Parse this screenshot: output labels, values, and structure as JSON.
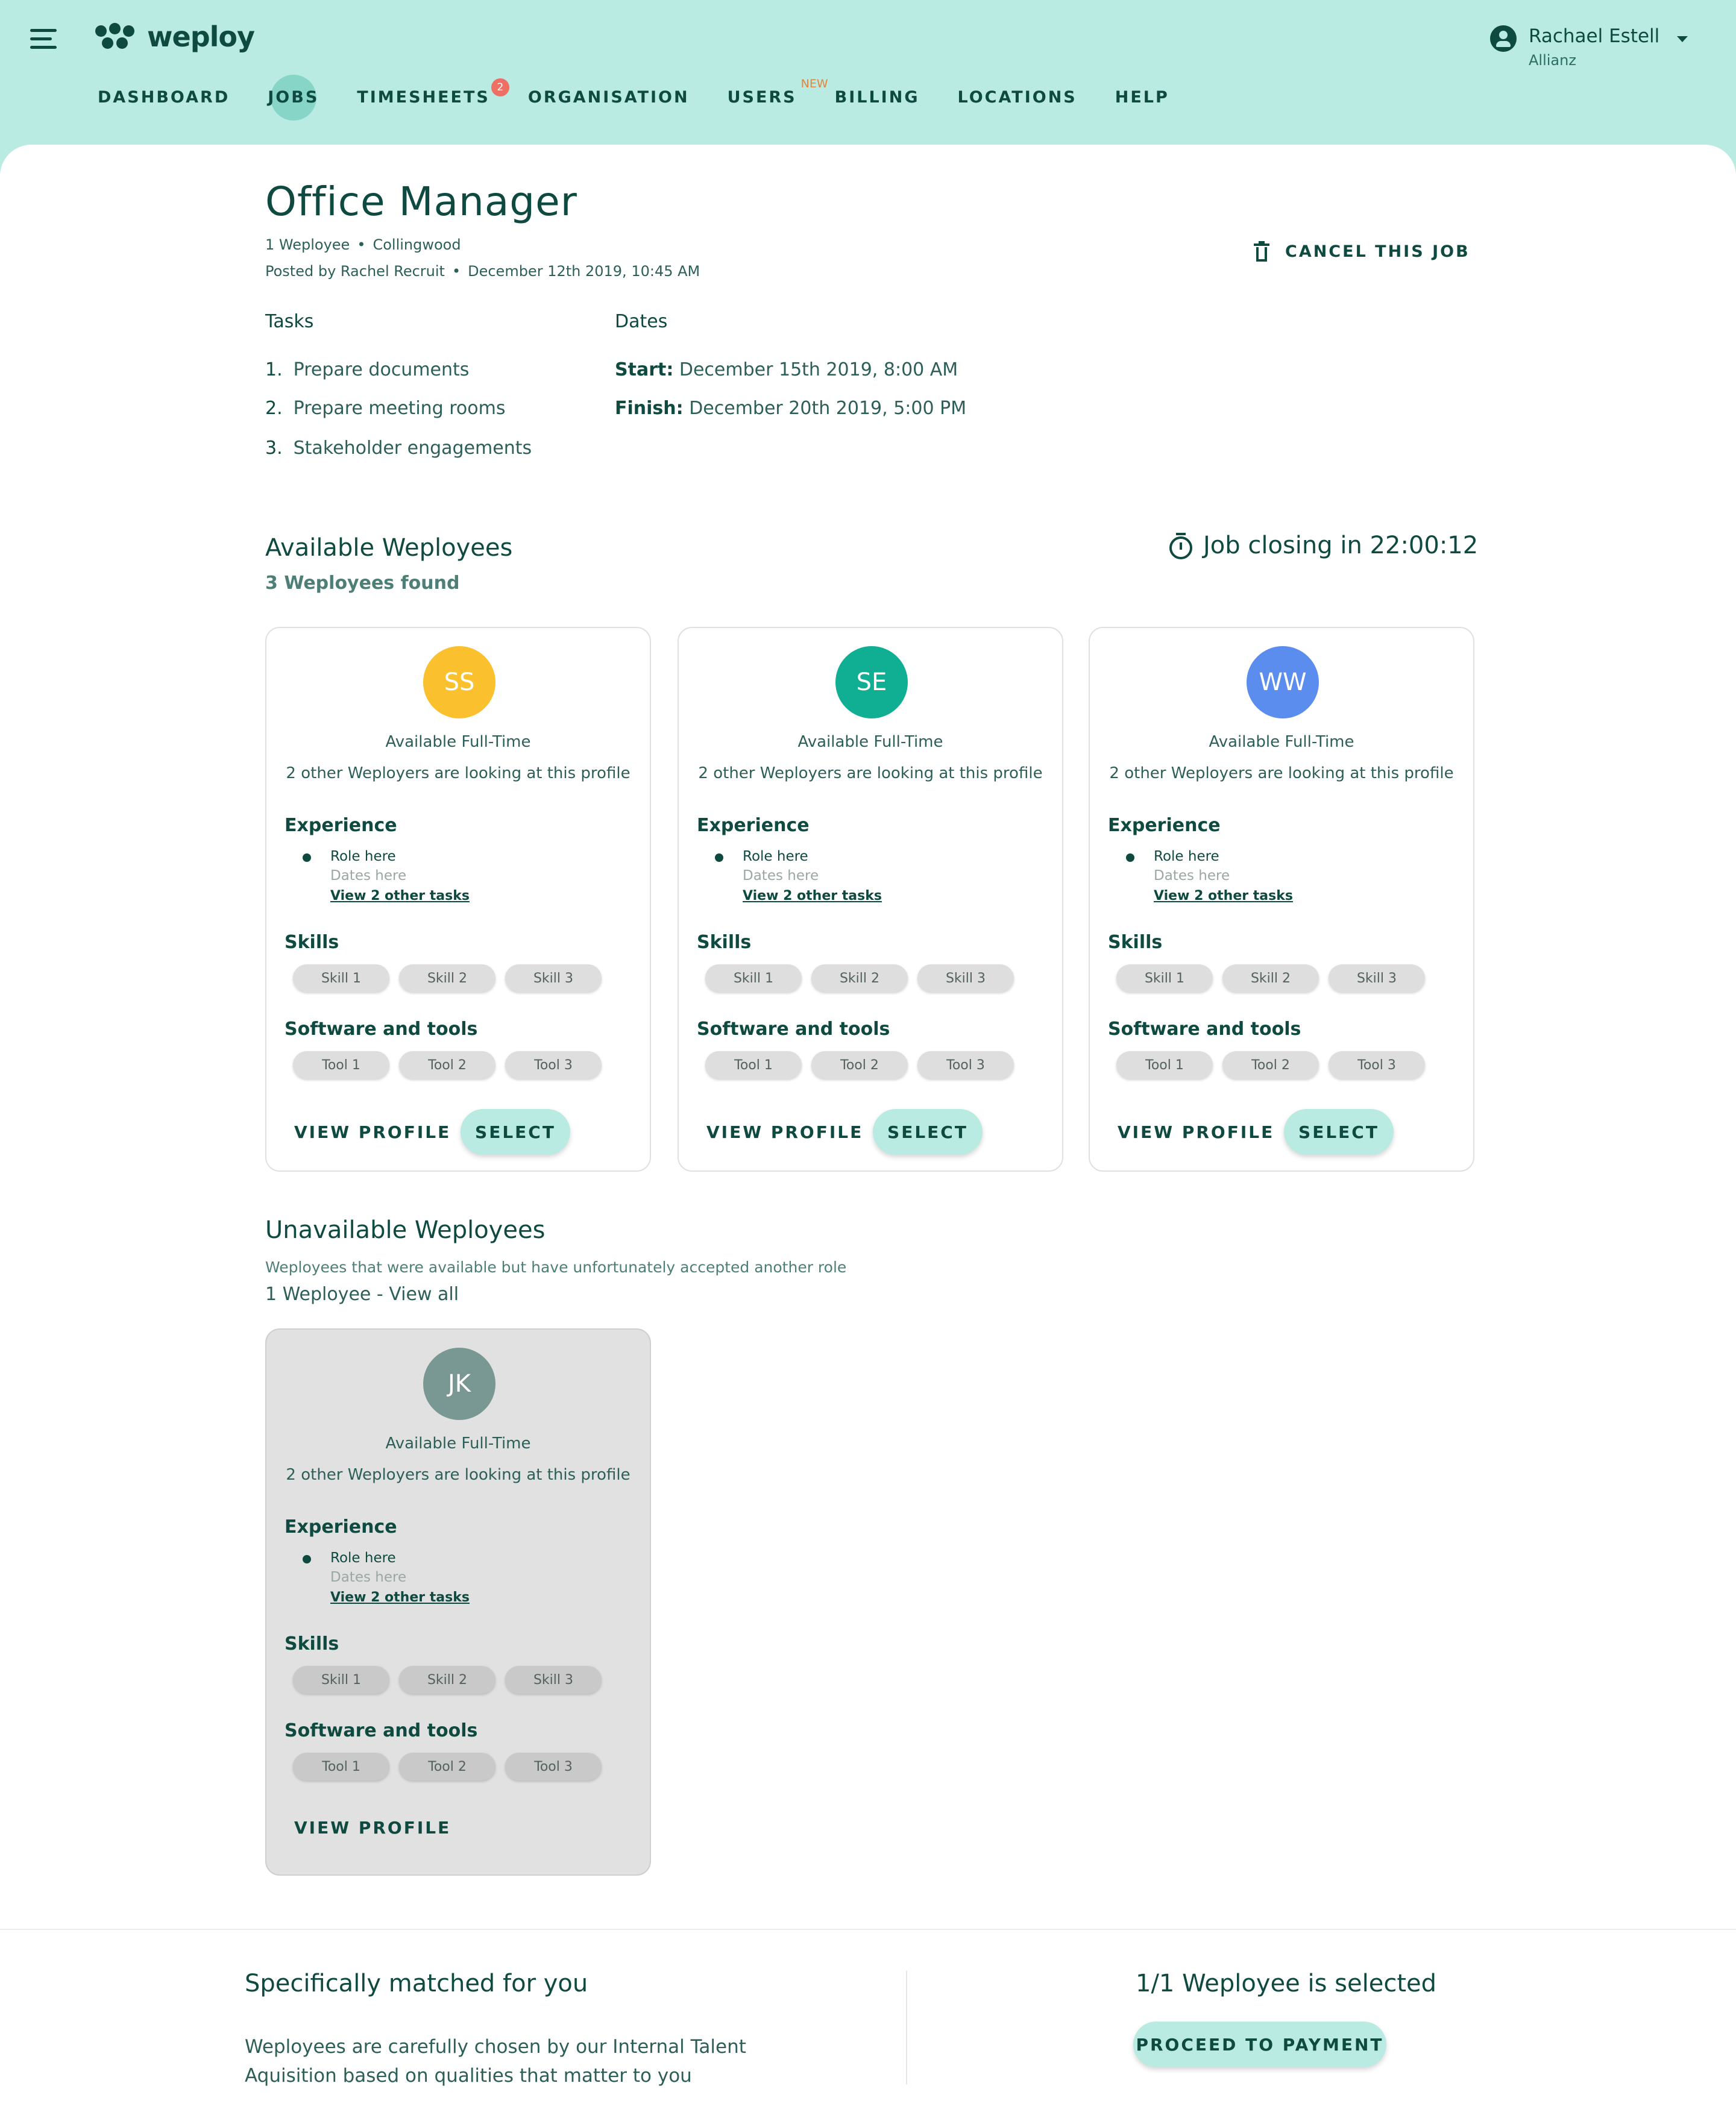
{
  "brand": {
    "name": "weploy",
    "primary": "#b9ebe3",
    "text": "#0e4a40",
    "badge": "#ee6f64",
    "new_tag": "#e8823a"
  },
  "header": {
    "menu_icon": "hamburger-icon",
    "nav": [
      {
        "label": "DASHBOARD",
        "active": false
      },
      {
        "label": "JOBS",
        "active": true
      },
      {
        "label": "TIMESHEETS",
        "active": false,
        "badge": "2"
      },
      {
        "label": "ORGANISATION",
        "active": false
      },
      {
        "label": "USERS",
        "active": false,
        "tag": "NEW"
      },
      {
        "label": "BILLING",
        "active": false
      },
      {
        "label": "LOCATIONS",
        "active": false
      },
      {
        "label": "HELP",
        "active": false
      }
    ],
    "user": {
      "name": "Rachael Estell",
      "org": "Allianz",
      "icon": "account-circle-icon"
    }
  },
  "job": {
    "title": "Office Manager",
    "weployees": "1 Weployee",
    "location": "Collingwood",
    "posted_by": "Posted by Rachel Recruit",
    "posted_at": "December 12th 2019, 10:45 AM",
    "cancel_label": "CANCEL THIS JOB",
    "tasks_heading": "Tasks",
    "tasks": [
      "Prepare documents",
      "Prepare meeting rooms",
      "Stakeholder engagements"
    ],
    "dates_heading": "Dates",
    "start_label": "Start:",
    "start": "December 15th 2019, 8:00 AM",
    "finish_label": "Finish:",
    "finish": "December 20th 2019, 5:00 PM"
  },
  "available": {
    "title": "Available Weployees",
    "found": "3 Weployees found",
    "closing": "Job closing in 22:00:12",
    "cards": [
      {
        "initials": "SS",
        "color": "#fbc02d"
      },
      {
        "initials": "SE",
        "color": "#10ae93"
      },
      {
        "initials": "WW",
        "color": "#5b8def"
      }
    ]
  },
  "card_common": {
    "availability": "Available Full-Time",
    "looking": "2 other Weployers are looking at this profile",
    "experience_heading": "Experience",
    "role": "Role here",
    "dates": "Dates here",
    "other_tasks": "View 2 other tasks",
    "skills_heading": "Skills",
    "skills": [
      "Skill 1",
      "Skill 2",
      "Skill 3"
    ],
    "tools_heading": "Software and tools",
    "tools": [
      "Tool 1",
      "Tool 2",
      "Tool 3"
    ],
    "view_profile": "VIEW PROFILE",
    "select": "SELECT"
  },
  "unavailable": {
    "title": "Unavailable Weployees",
    "subtitle": "Weployees that were available but have unfortunately accepted another role",
    "view_all": "1 Weployee - View all",
    "card": {
      "initials": "JK",
      "color": "#7a9893"
    }
  },
  "footer": {
    "title": "Specifically matched for you",
    "desc_line1": "Weployees are carefully chosen by our Internal Talent",
    "desc_line2": "Aquisition based on qualities that matter to you",
    "selected": "1/1 Weployee is selected",
    "proceed": "PROCEED TO PAYMENT"
  }
}
